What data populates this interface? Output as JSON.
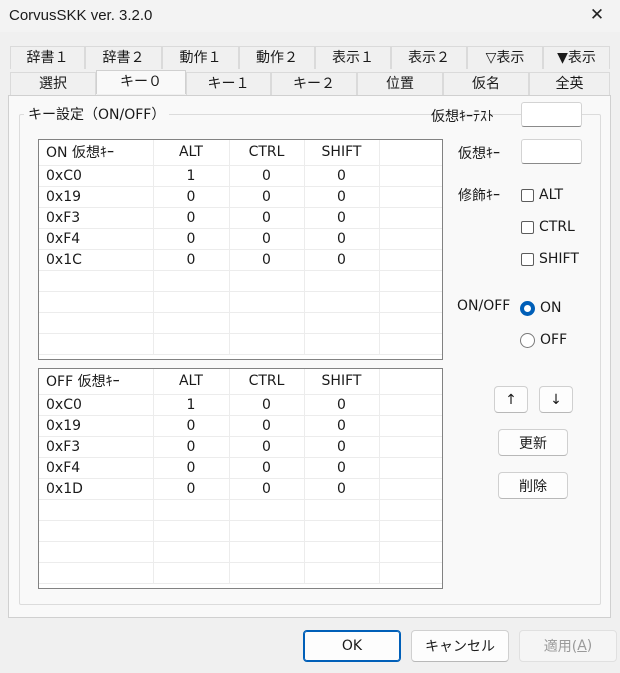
{
  "window": {
    "title": "CorvusSKK ver. 3.2.0",
    "close_glyph": "✕"
  },
  "tabs_row1": [
    "辞書１",
    "辞書２",
    "動作１",
    "動作２",
    "表示１",
    "表示２",
    "▽表示",
    "▼表示"
  ],
  "tabs_row2": [
    "選択",
    "キー０",
    "キー１",
    "キー２",
    "位置",
    "仮名",
    "全英"
  ],
  "active_tab": "キー０",
  "group_title": "キー設定（ON/OFF）",
  "on_list": {
    "columns": [
      "ON 仮想ｷｰ",
      "ALT",
      "CTRL",
      "SHIFT"
    ],
    "rows": [
      [
        "0xC0",
        "1",
        "0",
        "0"
      ],
      [
        "0x19",
        "0",
        "0",
        "0"
      ],
      [
        "0xF3",
        "0",
        "0",
        "0"
      ],
      [
        "0xF4",
        "0",
        "0",
        "0"
      ],
      [
        "0x1C",
        "0",
        "0",
        "0"
      ]
    ]
  },
  "off_list": {
    "columns": [
      "OFF 仮想ｷｰ",
      "ALT",
      "CTRL",
      "SHIFT"
    ],
    "rows": [
      [
        "0xC0",
        "1",
        "0",
        "0"
      ],
      [
        "0x19",
        "0",
        "0",
        "0"
      ],
      [
        "0xF3",
        "0",
        "0",
        "0"
      ],
      [
        "0xF4",
        "0",
        "0",
        "0"
      ],
      [
        "0x1D",
        "0",
        "0",
        "0"
      ]
    ]
  },
  "right_panel": {
    "virtual_key_test_label": "仮想ｷｰﾃｽﾄ",
    "virtual_key_label": "仮想ｷｰ",
    "modifier_label": "修飾ｷｰ",
    "modifiers": [
      {
        "label": "ALT",
        "checked": false
      },
      {
        "label": "CTRL",
        "checked": false
      },
      {
        "label": "SHIFT",
        "checked": false
      }
    ],
    "onoff_label": "ON/OFF",
    "radio_on": "ON",
    "radio_off": "OFF",
    "selected": "ON",
    "up_glyph": "↑",
    "down_glyph": "↓",
    "update_button": "更新",
    "delete_button": "削除"
  },
  "footer": {
    "ok": "OK",
    "cancel": "キャンセル",
    "apply_prefix": "適用(",
    "apply_mnemonic": "A",
    "apply_suffix": ")"
  }
}
